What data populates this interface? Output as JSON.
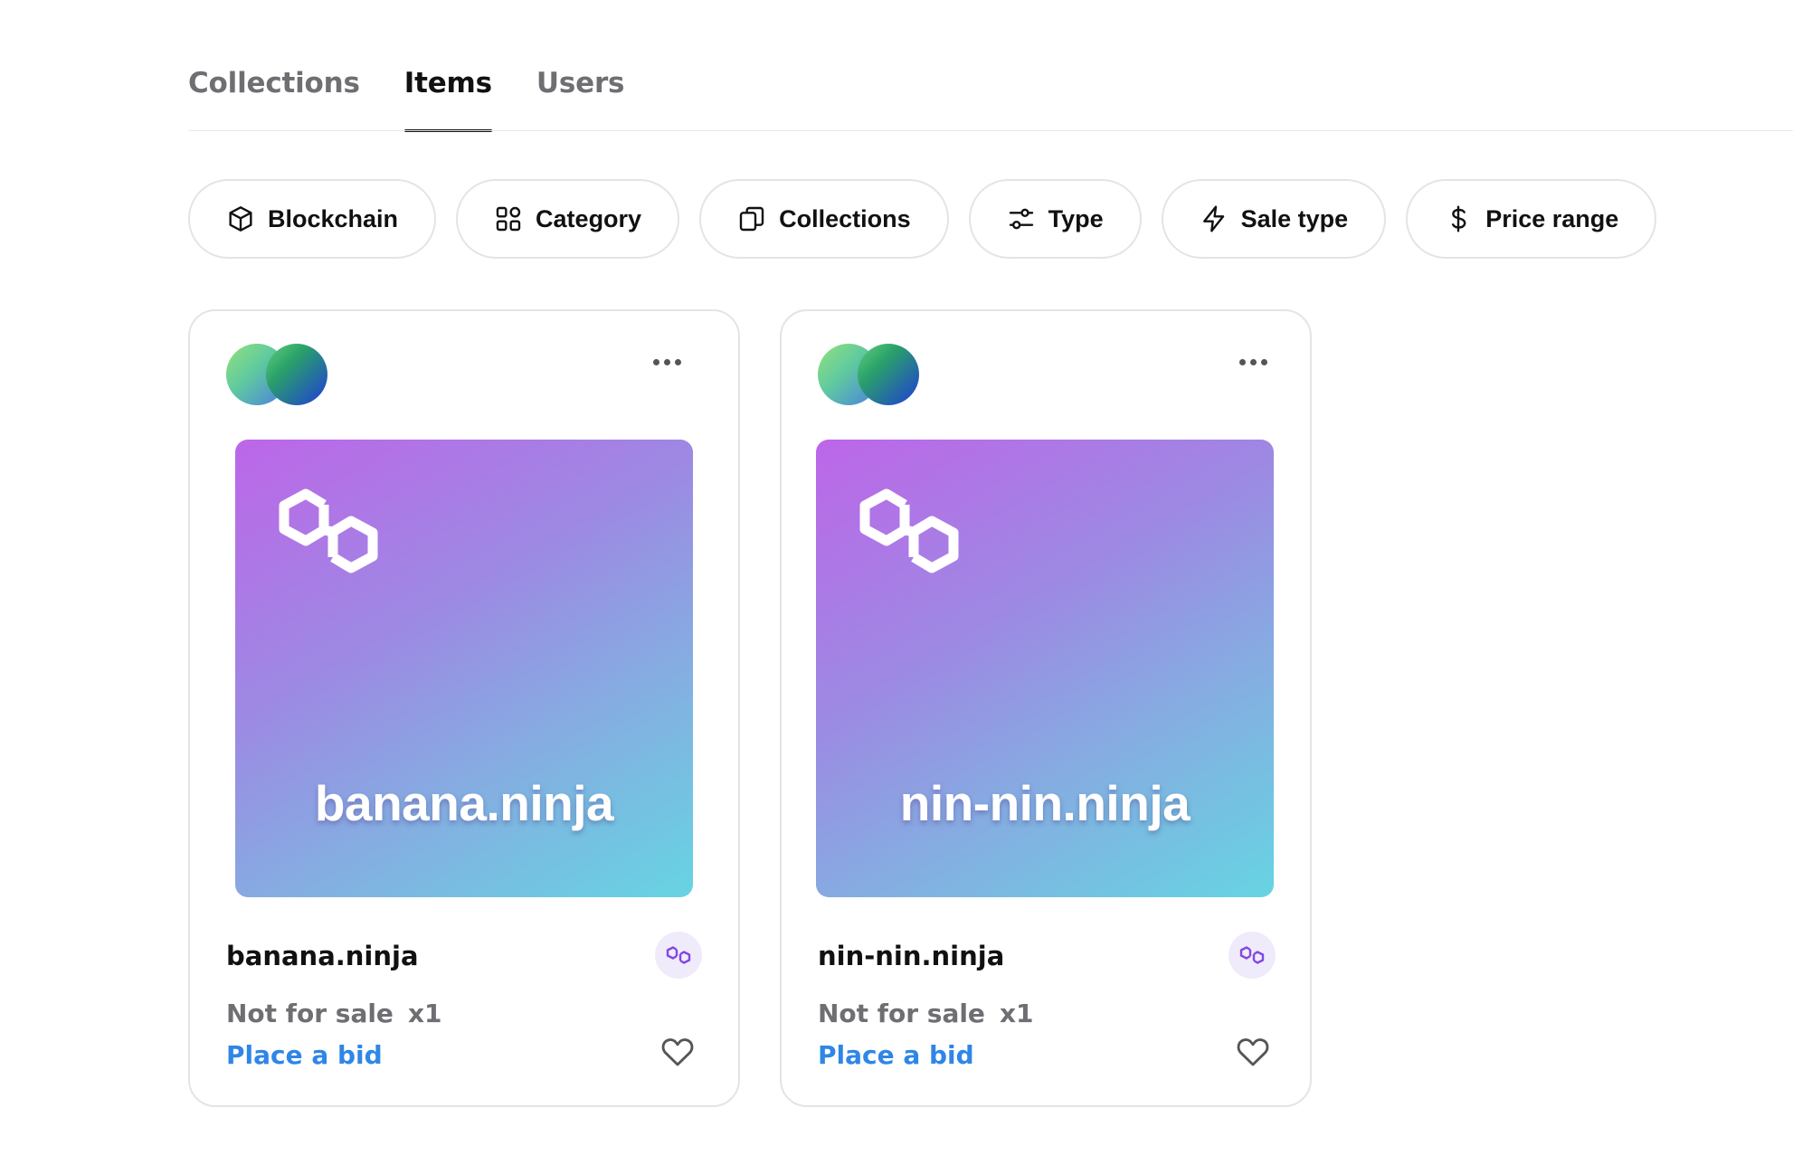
{
  "tabs": [
    {
      "label": "Collections",
      "active": false
    },
    {
      "label": "Items",
      "active": true
    },
    {
      "label": "Users",
      "active": false
    }
  ],
  "filters": [
    {
      "label": "Blockchain",
      "icon": "cube-icon"
    },
    {
      "label": "Category",
      "icon": "grid-icon"
    },
    {
      "label": "Collections",
      "icon": "cards-icon"
    },
    {
      "label": "Type",
      "icon": "sliders-icon"
    },
    {
      "label": "Sale type",
      "icon": "lightning-icon"
    },
    {
      "label": "Price range",
      "icon": "dollar-icon"
    }
  ],
  "cards": [
    {
      "art_title": "banana.ninja",
      "name": "banana.ninja",
      "sale_status": "Not for sale",
      "quantity": "x1",
      "bid_label": "Place a bid",
      "chain_icon": "polygon-icon"
    },
    {
      "art_title": "nin-nin.ninja",
      "name": "nin-nin.ninja",
      "sale_status": "Not for sale",
      "quantity": "x1",
      "bid_label": "Place a bid",
      "chain_icon": "polygon-icon"
    }
  ],
  "colors": {
    "accent_link": "#2f86e6",
    "art_gradient_start": "#bd66e8",
    "art_gradient_end": "#66d4e2",
    "polygon_purple": "#8247e5"
  }
}
